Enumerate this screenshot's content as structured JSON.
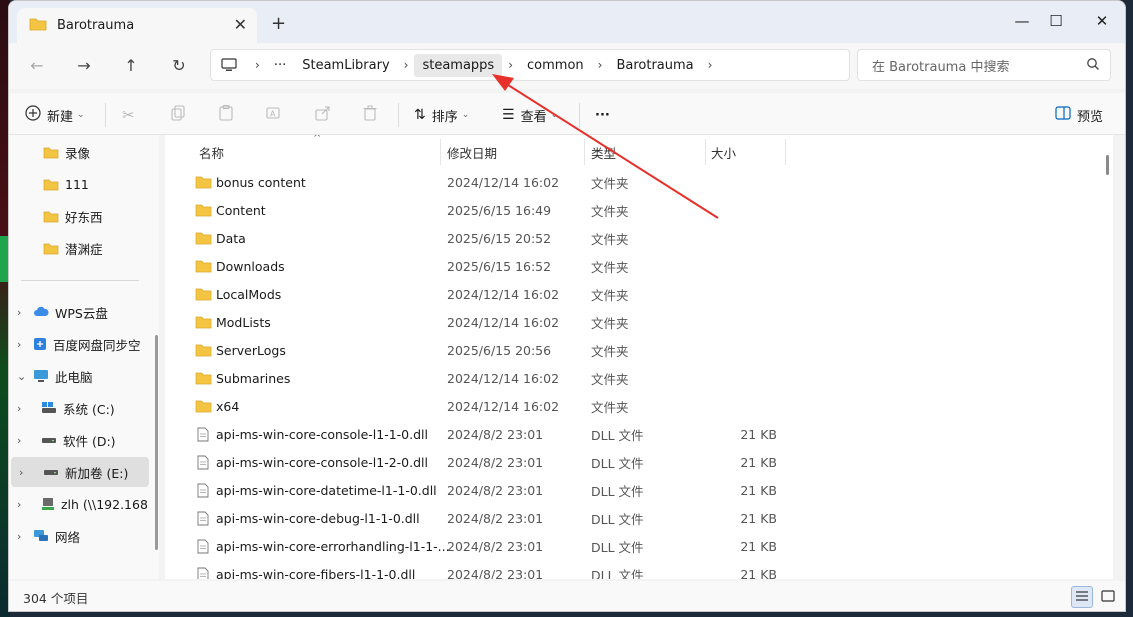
{
  "window": {
    "tab_title": "Barotrauma"
  },
  "address": {
    "crumbs": [
      "SteamLibrary",
      "steamapps",
      "common",
      "Barotrauma"
    ],
    "more_label": "···"
  },
  "search": {
    "placeholder": "在 Barotrauma 中搜索"
  },
  "toolbar": {
    "new_label": "新建",
    "sort_label": "排序",
    "view_label": "查看",
    "more_label": "···",
    "preview_label": "预览"
  },
  "sidebar": {
    "items": [
      {
        "label": "录像",
        "icon": "folder-icon"
      },
      {
        "label": "111",
        "icon": "folder-icon"
      },
      {
        "label": "好东西",
        "icon": "folder-icon"
      },
      {
        "label": "潜渊症",
        "icon": "folder-icon"
      },
      {
        "label": "WPS云盘",
        "icon": "cloud-icon"
      },
      {
        "label": "百度网盘同步空",
        "icon": "netdisk-icon"
      },
      {
        "label": "此电脑",
        "icon": "computer-icon"
      },
      {
        "label": "系统 (C:)",
        "icon": "drive-icon"
      },
      {
        "label": "软件 (D:)",
        "icon": "drive-icon"
      },
      {
        "label": "新加卷 (E:)",
        "icon": "drive-icon"
      },
      {
        "label": "zlh (\\\\192.168",
        "icon": "network-drive-icon"
      },
      {
        "label": "网络",
        "icon": "network-icon"
      }
    ]
  },
  "columns": {
    "name": "名称",
    "date": "修改日期",
    "type": "类型",
    "size": "大小"
  },
  "files": [
    {
      "name": "bonus content",
      "date": "2024/12/14 16:02",
      "type": "文件夹",
      "size": "",
      "kind": "folder"
    },
    {
      "name": "Content",
      "date": "2025/6/15 16:49",
      "type": "文件夹",
      "size": "",
      "kind": "folder"
    },
    {
      "name": "Data",
      "date": "2025/6/15 20:52",
      "type": "文件夹",
      "size": "",
      "kind": "folder"
    },
    {
      "name": "Downloads",
      "date": "2025/6/15 16:52",
      "type": "文件夹",
      "size": "",
      "kind": "folder"
    },
    {
      "name": "LocalMods",
      "date": "2024/12/14 16:02",
      "type": "文件夹",
      "size": "",
      "kind": "folder"
    },
    {
      "name": "ModLists",
      "date": "2024/12/14 16:02",
      "type": "文件夹",
      "size": "",
      "kind": "folder"
    },
    {
      "name": "ServerLogs",
      "date": "2025/6/15 20:56",
      "type": "文件夹",
      "size": "",
      "kind": "folder"
    },
    {
      "name": "Submarines",
      "date": "2024/12/14 16:02",
      "type": "文件夹",
      "size": "",
      "kind": "folder"
    },
    {
      "name": "x64",
      "date": "2024/12/14 16:02",
      "type": "文件夹",
      "size": "",
      "kind": "folder"
    },
    {
      "name": "api-ms-win-core-console-l1-1-0.dll",
      "date": "2024/8/2 23:01",
      "type": "DLL 文件",
      "size": "21 KB",
      "kind": "file"
    },
    {
      "name": "api-ms-win-core-console-l1-2-0.dll",
      "date": "2024/8/2 23:01",
      "type": "DLL 文件",
      "size": "21 KB",
      "kind": "file"
    },
    {
      "name": "api-ms-win-core-datetime-l1-1-0.dll",
      "date": "2024/8/2 23:01",
      "type": "DLL 文件",
      "size": "21 KB",
      "kind": "file"
    },
    {
      "name": "api-ms-win-core-debug-l1-1-0.dll",
      "date": "2024/8/2 23:01",
      "type": "DLL 文件",
      "size": "21 KB",
      "kind": "file"
    },
    {
      "name": "api-ms-win-core-errorhandling-l1-1-...",
      "date": "2024/8/2 23:01",
      "type": "DLL 文件",
      "size": "21 KB",
      "kind": "file"
    },
    {
      "name": "api-ms-win-core-fibers-l1-1-0.dll",
      "date": "2024/8/2 23:01",
      "type": "DLL 文件",
      "size": "21 KB",
      "kind": "file"
    }
  ],
  "status": {
    "item_count": "304 个项目"
  },
  "colors": {
    "folder": "#f4c542",
    "annotation_arrow": "#e8302a",
    "accent": "#0067c0"
  }
}
